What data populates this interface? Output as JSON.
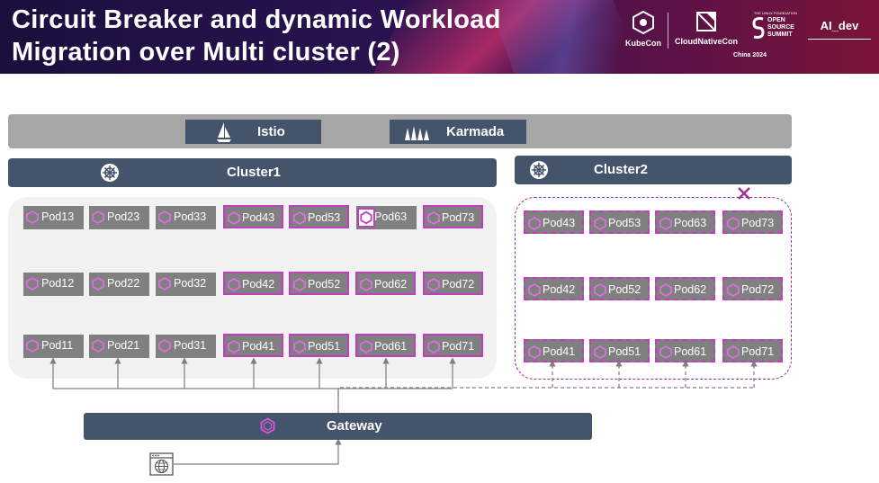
{
  "header": {
    "title_line1": "Circuit Breaker and dynamic Workload",
    "title_line2": "Migration over Multi cluster (2)",
    "logos": [
      {
        "name": "kubecon-logo",
        "caption": "KubeCon"
      },
      {
        "name": "cloudnativecon-logo",
        "caption": "CloudNativeCon"
      },
      {
        "name": "oss-logo",
        "caption": "OPEN SOURCE SUMMIT"
      },
      {
        "name": "ai-dev-logo",
        "caption": "AI_dev"
      }
    ],
    "event_location": "China 2024",
    "linux_foundation": "THE LINUX FOUNDATION"
  },
  "control_plane": {
    "istio_label": "Istio",
    "karmada_label": "Karmada"
  },
  "cluster1": {
    "label": "Cluster1",
    "rows": [
      [
        "Pod13",
        "Pod23",
        "Pod33",
        "Pod43",
        "Pod53",
        "Pod63",
        "Pod73"
      ],
      [
        "Pod12",
        "Pod22",
        "Pod32",
        "Pod42",
        "Pod52",
        "Pod62",
        "Pod72"
      ],
      [
        "Pod11",
        "Pod21",
        "Pod31",
        "Pod41",
        "Pod51",
        "Pod61",
        "Pod71"
      ]
    ]
  },
  "cluster2": {
    "label": "Cluster2",
    "rows": [
      [
        "Pod43",
        "Pod53",
        "Pod63",
        "Pod73"
      ],
      [
        "Pod42",
        "Pod52",
        "Pod62",
        "Pod72"
      ],
      [
        "Pod41",
        "Pod51",
        "Pod61",
        "Pod71"
      ]
    ]
  },
  "gateway": {
    "label": "Gateway"
  },
  "colors": {
    "header_navy": "#44546a",
    "pod_gray": "#808080",
    "highlight_magenta": "#c03ec0",
    "failed_cluster_border": "#9b2c95",
    "top_bar_gray": "#a6a6a6"
  }
}
